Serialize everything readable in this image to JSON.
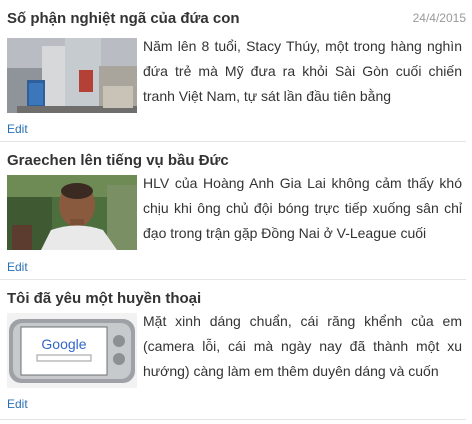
{
  "articles": [
    {
      "title": "Số phận nghiệt ngã của đứa con",
      "date": "24/4/2015",
      "summary": "Năm lên 8 tuổi, Stacy Thúy, một trong hàng nghìn đứa trẻ mà Mỹ đưa ra khỏi Sài Gòn cuối chiến tranh Việt Nam, tự sát lần đầu tiên bằng",
      "edit_label": "Edit"
    },
    {
      "title": "Graechen lên tiếng vụ bầu Đức",
      "summary": "HLV của Hoàng Anh Gia Lai không cảm thấy khó chịu khi ông chủ đội bóng trực tiếp xuống sân chỉ đạo trong trận gặp Đồng Nai ở V-League cuối",
      "edit_label": "Edit"
    },
    {
      "title": "Tôi đã yêu một huyền thoại",
      "summary": "Mặt xinh dáng chuẩn, cái răng khểnh của em (camera lỗi, cái mà ngày nay đã thành một xu hướng) càng làm em thêm duyên dáng và cuốn",
      "edit_label": "Edit"
    }
  ],
  "thumb3_screen_text": "Google"
}
